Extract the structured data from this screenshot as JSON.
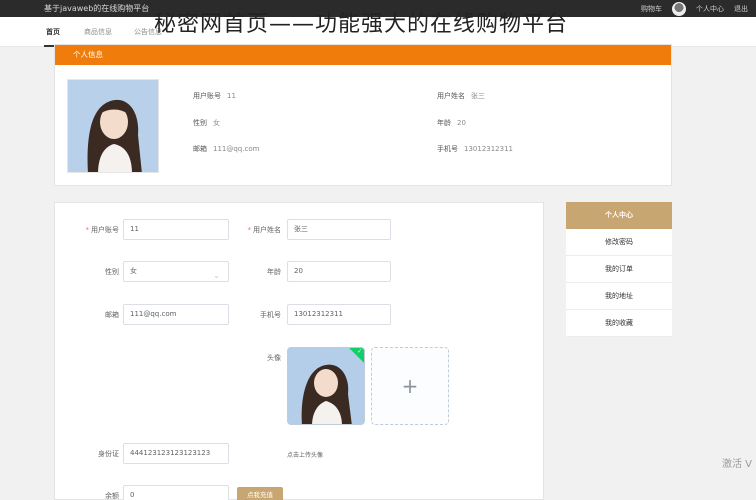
{
  "overlay_title": "秘密网首页——功能强大的在线购物平台",
  "topbar": {
    "site_name": "基于javaweb的在线购物平台",
    "cart": "购物车",
    "user_center": "个人中心",
    "logout": "退出"
  },
  "nav": {
    "items": [
      {
        "label": "首页",
        "active": true
      },
      {
        "label": "商品信息",
        "active": false
      },
      {
        "label": "公告信息",
        "active": false
      }
    ]
  },
  "info": {
    "header": "个人信息",
    "fields": [
      {
        "key": "用户账号",
        "value": "11"
      },
      {
        "key": "用户姓名",
        "value": "张三"
      },
      {
        "key": "性别",
        "value": "女"
      },
      {
        "key": "年龄",
        "value": "20"
      },
      {
        "key": "邮箱",
        "value": "111@qq.com"
      },
      {
        "key": "手机号",
        "value": "13012312311"
      }
    ]
  },
  "form": {
    "account_label": "用户账号",
    "account_value": "11",
    "name_label": "用户姓名",
    "name_value": "张三",
    "gender_label": "性别",
    "gender_value": "女",
    "age_label": "年龄",
    "age_value": "20",
    "email_label": "邮箱",
    "email_value": "111@qq.com",
    "phone_label": "手机号",
    "phone_value": "13012312311",
    "avatar_label": "头像",
    "upload_hint": "点击上传头像",
    "idcard_label": "身份证",
    "idcard_value": "444123123123123123",
    "balance_label": "余额",
    "balance_value": "0",
    "recharge_button": "点我充值"
  },
  "menu": {
    "header": "个人中心",
    "items": [
      "修改密码",
      "我的订单",
      "我的地址",
      "我的收藏"
    ]
  },
  "activate_text": "激活 V",
  "colors": {
    "topbar": "#2b2b2b",
    "info_header": "#f07c0c",
    "accent_gold": "#c8a671",
    "upload_success": "#13ce66",
    "required": "#f56c6c"
  },
  "icons": {
    "upload_add": "plus-icon",
    "select_caret": "chevron-down-icon",
    "success_mark": "check-icon"
  }
}
